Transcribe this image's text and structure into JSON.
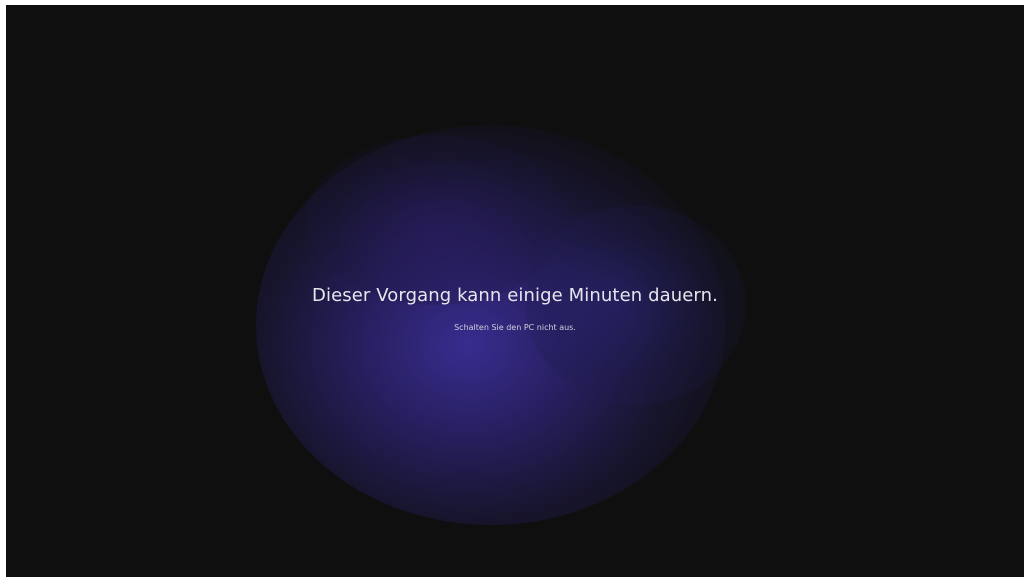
{
  "setup_screen": {
    "headline": "Dieser Vorgang kann einige Minuten dauern.",
    "subline": "Schalten Sie den PC nicht aus.",
    "background_color": "#0f0f0f",
    "glow_color": "#3a2e96"
  }
}
